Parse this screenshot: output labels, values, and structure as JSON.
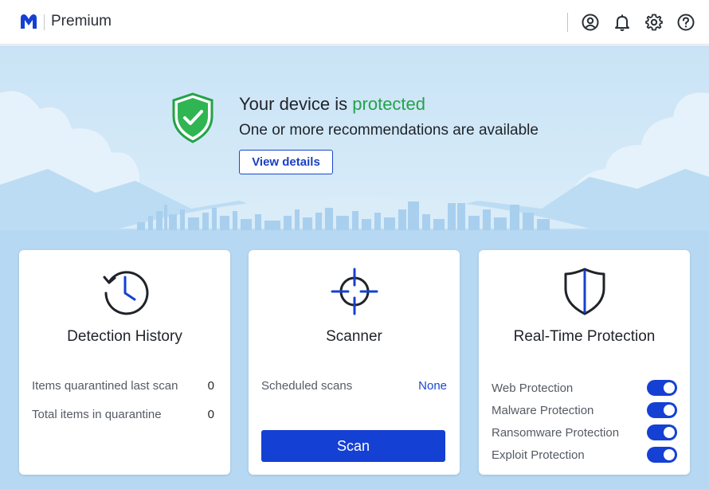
{
  "header": {
    "app_title": "Premium",
    "logo_icon": "malwarebytes-logo-icon",
    "icons": [
      "account-icon",
      "notifications-bell-icon",
      "settings-gear-icon",
      "help-icon"
    ]
  },
  "status": {
    "headline_prefix": "Your device is ",
    "headline_status": "protected",
    "subline": "One or more recommendations are available",
    "view_details_label": "View details",
    "status_color": "#23a347",
    "icon": "shield-check-icon"
  },
  "cards": {
    "detection_history": {
      "title": "Detection History",
      "icon": "clock-history-icon",
      "rows": [
        {
          "label": "Items quarantined last scan",
          "value": "0"
        },
        {
          "label": "Total items in quarantine",
          "value": "0"
        }
      ]
    },
    "scanner": {
      "title": "Scanner",
      "icon": "crosshair-icon",
      "scheduled_label": "Scheduled scans",
      "scheduled_value": "None",
      "scan_button_label": "Scan"
    },
    "real_time_protection": {
      "title": "Real-Time Protection",
      "icon": "shield-outline-icon",
      "toggles": [
        {
          "label": "Web Protection",
          "on": true
        },
        {
          "label": "Malware Protection",
          "on": true
        },
        {
          "label": "Ransomware Protection",
          "on": true
        },
        {
          "label": "Exploit Protection",
          "on": true
        }
      ]
    }
  },
  "colors": {
    "accent": "#1540d4",
    "protected_green": "#23a347"
  }
}
